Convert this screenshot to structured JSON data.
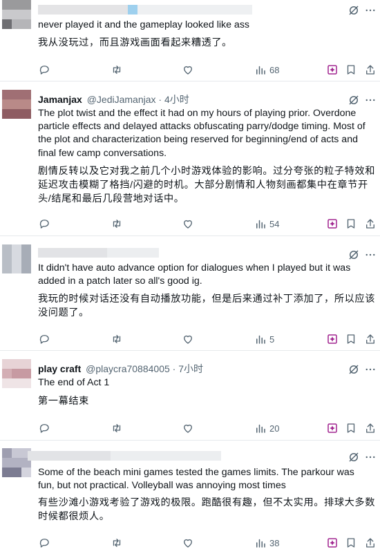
{
  "tweets": [
    {
      "name": "",
      "handle": "",
      "time": "",
      "text": "never played it and the gameplay looked like ass",
      "translation": "我从没玩过，而且游戏画面看起来糟透了。",
      "views": "68"
    },
    {
      "name": "Jamanjax",
      "handle": "@JediJamanjax",
      "time": "4小时",
      "text": "The plot twist and the effect it had on my hours of playing prior. Overdone particle effects and delayed attacks obfuscating parry/dodge timing. Most of the plot and characterization being reserved for beginning/end of acts and final few camp conversations.",
      "translation": "剧情反转以及它对我之前几个小时游戏体验的影响。过分夸张的粒子特效和延迟攻击模糊了格挡/闪避的时机。大部分剧情和人物刻画都集中在章节开头/结尾和最后几段营地对话中。",
      "views": "54"
    },
    {
      "name": "",
      "handle": "",
      "time": "",
      "text": "It didn't have auto advance option for dialogues when I played but it was added in a patch later so all's good ig.",
      "translation": "我玩的时候对话还没有自动播放功能，但是后来通过补丁添加了，所以应该没问题了。",
      "views": "5"
    },
    {
      "name": "play craft",
      "handle": "@playcra70884005",
      "time": "7小时",
      "text": "The end of Act 1",
      "translation": "第一幕结束",
      "views": "20"
    },
    {
      "name": "",
      "handle": "",
      "time": "",
      "text": "Some of the beach mini games tested the games limits. The parkour was fun, but not practical. Volleyball was annoying most times",
      "translation": "有些沙滩小游戏考验了游戏的极限。跑酷很有趣，但不太实用。排球大多数时候都很烦人。",
      "views": "38"
    }
  ],
  "icons": {
    "reply": "reply-icon",
    "retweet": "retweet-icon",
    "like": "like-icon",
    "views": "views-icon",
    "grok": "grok-icon",
    "bookmark": "bookmark-icon",
    "share": "share-icon",
    "more": "more-icon"
  },
  "colors": {
    "text": "#0f1419",
    "secondary": "#536471",
    "divider": "#e6e9ec",
    "grok": "#a1248f"
  }
}
